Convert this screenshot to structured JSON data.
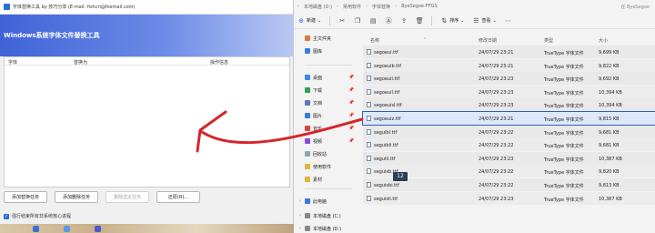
{
  "tool": {
    "window_title": "字体替换工具 by 技巧分享 (E-mail: fishcri@foxmail.com)",
    "banner_title": "Windows系统字体文件替换工具",
    "columns": [
      "字体",
      "替换为",
      "操作信息"
    ],
    "buttons": [
      "添加替换任务",
      "添加删除任务",
      "删除选定任务",
      "还原(R)..."
    ],
    "checkbox_label": "强行结束所有非系统核心进程",
    "checkbox_checked": true
  },
  "explorer": {
    "breadcrumbs": [
      "本地磁盘 (D:)",
      "常用软件",
      "字体替换",
      "ByeSegoe-FFGS"
    ],
    "search_hint": "在 ByeSegoe",
    "toolbar": {
      "new_label": "新建",
      "sort_label": "排序",
      "view_label": "查看"
    },
    "sidebar": [
      {
        "label": "主文件夹",
        "icon": "home-icon",
        "color": "#e07a3a"
      },
      {
        "label": "图库",
        "icon": "gallery-icon",
        "color": "#3a7ae0"
      },
      {
        "label": "桌面",
        "icon": "desktop-icon",
        "color": "#3a8ae0"
      },
      {
        "label": "下载",
        "icon": "download-icon",
        "color": "#2f9e57"
      },
      {
        "label": "文档",
        "icon": "document-icon",
        "color": "#5a7ab5"
      },
      {
        "label": "图片",
        "icon": "pictures-icon",
        "color": "#3a7ae0"
      },
      {
        "label": "音乐",
        "icon": "music-icon",
        "color": "#e0453a"
      },
      {
        "label": "视频",
        "icon": "video-icon",
        "color": "#8a4ae0"
      },
      {
        "label": "回收站",
        "icon": "recycle-bin-icon",
        "color": "#8aa"
      },
      {
        "label": "使用软件",
        "icon": "folder-icon",
        "color": "#e0b43a"
      },
      {
        "label": "素材",
        "icon": "folder-icon",
        "color": "#e0b43a"
      },
      {
        "label": "此电脑",
        "icon": "computer-icon",
        "color": "#3a7ae0"
      },
      {
        "label": "本地磁盘 (C:)",
        "icon": "drive-icon",
        "color": "#888"
      },
      {
        "label": "本地磁盘 (D:)",
        "icon": "drive-icon",
        "color": "#888"
      }
    ],
    "columns": [
      "名称",
      "修改日期",
      "类型",
      "大小"
    ],
    "files": [
      {
        "name": "segoeui.ttf",
        "date": "24/07/29 23:21",
        "type": "TrueType 字体文件",
        "size": "9,699 KB"
      },
      {
        "name": "segoeuib.ttf",
        "date": "24/07/29 23:21",
        "type": "TrueType 字体文件",
        "size": "9,822 KB"
      },
      {
        "name": "segoeuii.ttf",
        "date": "24/07/29 23:23",
        "type": "TrueType 字体文件",
        "size": "9,692 KB"
      },
      {
        "name": "segoeuil.ttf",
        "date": "24/07/29 23:23",
        "type": "TrueType 字体文件",
        "size": "10,394 KB"
      },
      {
        "name": "segoeuisl.ttf",
        "date": "24/07/29 23:23",
        "type": "TrueType 字体文件",
        "size": "10,394 KB"
      },
      {
        "name": "segoeuiz.ttf",
        "date": "24/07/29 23:21",
        "type": "TrueType 字体文件",
        "size": "9,815 KB",
        "selected": true
      },
      {
        "name": "seguibl.ttf",
        "date": "24/07/29 23:22",
        "type": "TrueType 字体文件",
        "size": "9,681 KB"
      },
      {
        "name": "seguibli.ttf",
        "date": "24/07/29 23:22",
        "type": "TrueType 字体文件",
        "size": "9,681 KB"
      },
      {
        "name": "seguili.ttf",
        "date": "24/07/29 23:23",
        "type": "TrueType 字体文件",
        "size": "10,387 KB"
      },
      {
        "name": "seguisb.ttf",
        "date": "24/07/29 23:22",
        "type": "TrueType 字体文件",
        "size": "9,820 KB"
      },
      {
        "name": "seguisbi.ttf",
        "date": "24/07/29 23:22",
        "type": "TrueType 字体文件",
        "size": "9,813 KB"
      },
      {
        "name": "seguisli.ttf",
        "date": "24/07/29 23:23",
        "type": "TrueType 字体文件",
        "size": "10,387 KB"
      }
    ],
    "badge": "12"
  },
  "colors": {
    "accent": "#2b6fd6",
    "banner": "#4a6ee0",
    "arrow": "#d4262c",
    "selection": "#2f5fb3"
  }
}
